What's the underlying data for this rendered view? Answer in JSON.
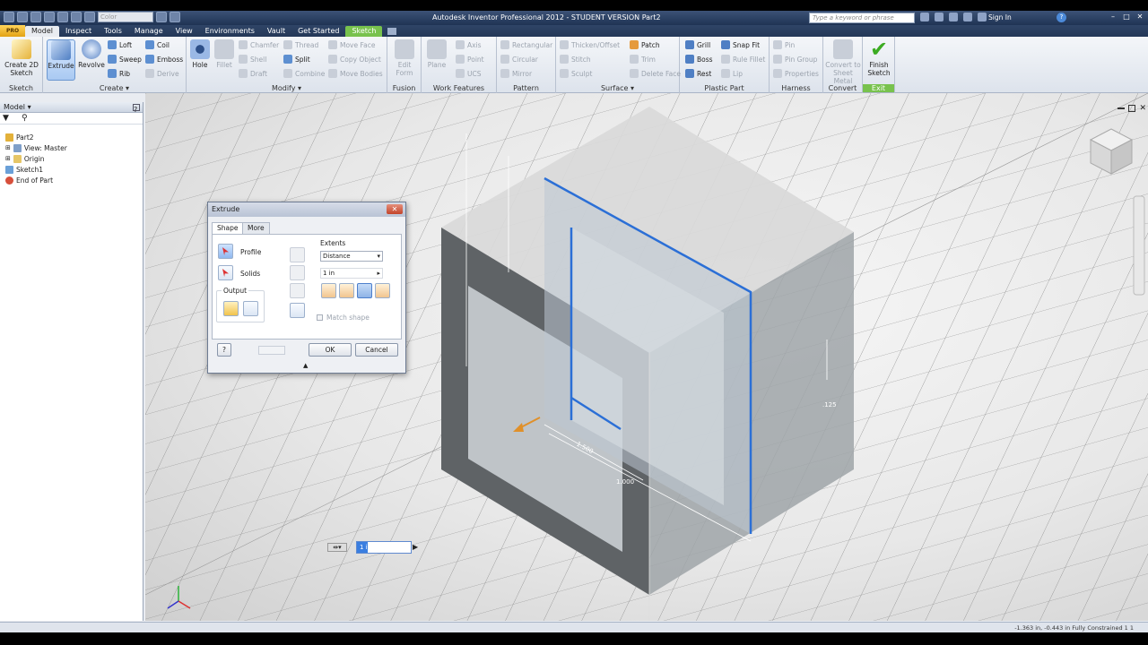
{
  "window": {
    "title": "Autodesk Inventor Professional 2012 - STUDENT VERSION   Part2",
    "color_combo": "Color",
    "search_placeholder": "Type a keyword or phrase",
    "sign_in": "Sign In"
  },
  "app_button": "PRO",
  "tabs": [
    "Model",
    "Inspect",
    "Tools",
    "Manage",
    "View",
    "Environments",
    "Vault",
    "Get Started",
    "Sketch"
  ],
  "ribbon": {
    "sketch": {
      "create_2d_sketch": "Create 2D Sketch",
      "label": "Sketch"
    },
    "create": {
      "extrude": "Extrude",
      "revolve": "Revolve",
      "loft": "Loft",
      "sweep": "Sweep",
      "rib": "Rib",
      "coil": "Coil",
      "emboss": "Emboss",
      "derive": "Derive",
      "label": "Create"
    },
    "modify": {
      "hole": "Hole",
      "fillet": "Fillet",
      "chamfer": "Chamfer",
      "shell": "Shell",
      "draft": "Draft",
      "thread": "Thread",
      "split": "Split",
      "combine": "Combine",
      "move_face": "Move Face",
      "copy_object": "Copy Object",
      "move_bodies": "Move Bodies",
      "label": "Modify"
    },
    "fusion": {
      "edit_form": "Edit Form",
      "label": "Fusion"
    },
    "work_features": {
      "plane": "Plane",
      "axis": "Axis",
      "point": "Point",
      "ucs": "UCS",
      "label": "Work Features"
    },
    "pattern": {
      "rectangular": "Rectangular",
      "circular": "Circular",
      "mirror": "Mirror",
      "label": "Pattern"
    },
    "surface": {
      "thicken_offset": "Thicken/Offset",
      "stitch": "Stitch",
      "sculpt": "Sculpt",
      "patch": "Patch",
      "trim": "Trim",
      "delete_face": "Delete Face",
      "label": "Surface"
    },
    "plastic_part": {
      "grill": "Grill",
      "boss": "Boss",
      "rest": "Rest",
      "snap_fit": "Snap Fit",
      "rule_fillet": "Rule Fillet",
      "lip": "Lip",
      "label": "Plastic Part"
    },
    "harness": {
      "pin": "Pin",
      "pin_group": "Pin Group",
      "properties": "Properties",
      "label": "Harness"
    },
    "convert": {
      "convert_to_sheet_metal": "Convert to Sheet Metal",
      "label": "Convert"
    },
    "exit": {
      "finish_sketch": "Finish Sketch",
      "label": "Exit"
    }
  },
  "browser": {
    "title": "Model",
    "items": [
      {
        "label": "Part2"
      },
      {
        "label": "View: Master"
      },
      {
        "label": "Origin"
      },
      {
        "label": "Sketch1"
      },
      {
        "label": "End of Part"
      }
    ]
  },
  "dialog": {
    "title": "Extrude",
    "tabs": [
      "Shape",
      "More"
    ],
    "profile": "Profile",
    "solids": "Solids",
    "output": "Output",
    "extents": "Extents",
    "extents_type": "Distance",
    "distance": "1 in",
    "match_shape": "Match shape",
    "ok": "OK",
    "cancel": "Cancel"
  },
  "viewport": {
    "dimensions": [
      "1.500",
      "1.000",
      ".125"
    ]
  },
  "minitoolbar": {
    "value": "1 in"
  },
  "status": {
    "text": "-1.363 in, -0.443 in   Fully Constrained   1   1"
  },
  "colors": {
    "accent_blue": "#2b6fd6",
    "sketch_green": "#78c24d",
    "title_bg": "#2a3f61"
  }
}
